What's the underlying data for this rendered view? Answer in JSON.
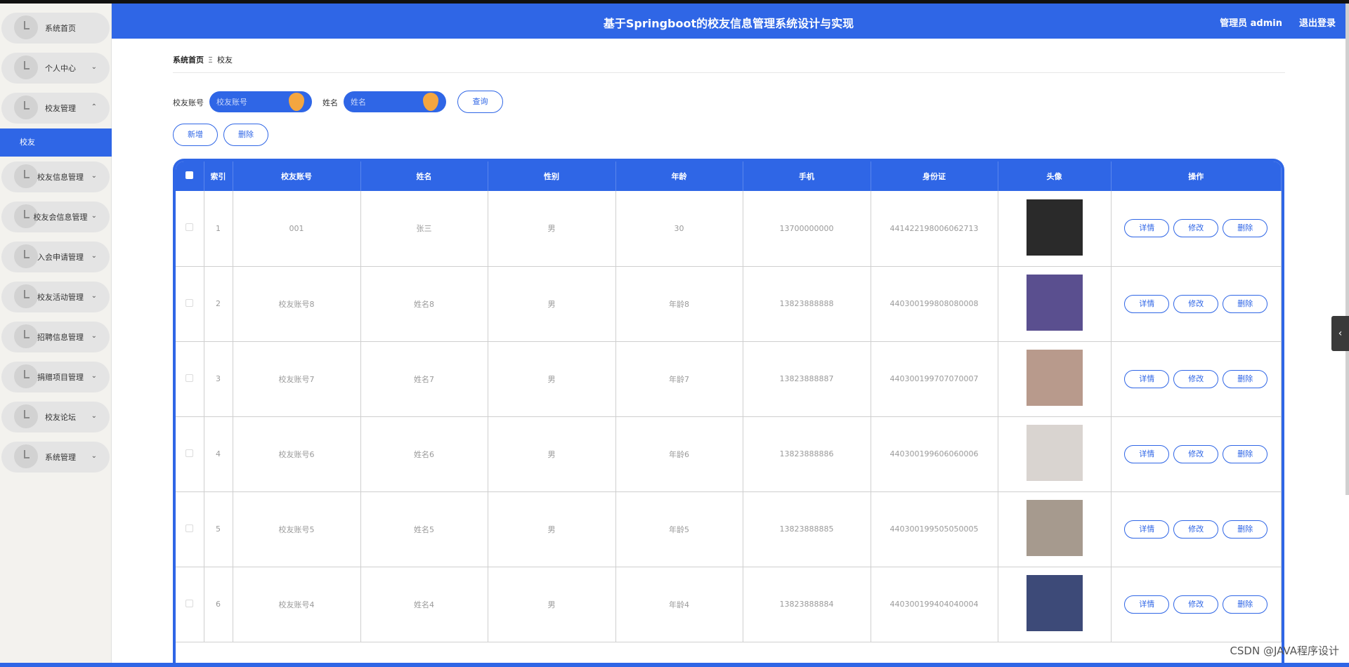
{
  "header": {
    "title": "基于Springboot的校友信息管理系统设计与实现",
    "user": "管理员 admin",
    "logout": "退出登录"
  },
  "sidebar": {
    "items": [
      {
        "label": "系统首页",
        "chevron": ""
      },
      {
        "label": "个人中心",
        "chevron": "⌄"
      },
      {
        "label": "校友管理",
        "chevron": "⌃"
      },
      {
        "label": "校友信息管理",
        "chevron": "⌄"
      },
      {
        "label": "校友会信息管理",
        "chevron": "⌄"
      },
      {
        "label": "入会申请管理",
        "chevron": "⌄"
      },
      {
        "label": "校友活动管理",
        "chevron": "⌄"
      },
      {
        "label": "招聘信息管理",
        "chevron": "⌄"
      },
      {
        "label": "捐赠项目管理",
        "chevron": "⌄"
      },
      {
        "label": "校友论坛",
        "chevron": "⌄"
      },
      {
        "label": "系统管理",
        "chevron": "⌄"
      }
    ],
    "active_sub": "校友"
  },
  "breadcrumb": {
    "home": "系统首页",
    "sep": "Ξ",
    "current": "校友"
  },
  "search": {
    "account_label": "校友账号",
    "account_placeholder": "校友账号",
    "name_label": "姓名",
    "name_placeholder": "姓名",
    "query_button": "查询"
  },
  "actions": {
    "add": "新增",
    "delete": "删除"
  },
  "table": {
    "headers": [
      "",
      "索引",
      "校友账号",
      "姓名",
      "性别",
      "年龄",
      "手机",
      "身份证",
      "头像",
      "操作"
    ],
    "op_labels": {
      "detail": "详情",
      "edit": "修改",
      "delete": "删除"
    },
    "rows": [
      {
        "index": "1",
        "account": "001",
        "name": "张三",
        "gender": "男",
        "age": "30",
        "phone": "13700000000",
        "id_card": "441422198006062713",
        "avatar_color": "#2a2a2a"
      },
      {
        "index": "2",
        "account": "校友账号8",
        "name": "姓名8",
        "gender": "男",
        "age": "年龄8",
        "phone": "13823888888",
        "id_card": "440300199808080008",
        "avatar_color": "#5a4f8f"
      },
      {
        "index": "3",
        "account": "校友账号7",
        "name": "姓名7",
        "gender": "男",
        "age": "年龄7",
        "phone": "13823888887",
        "id_card": "440300199707070007",
        "avatar_color": "#b89a8c"
      },
      {
        "index": "4",
        "account": "校友账号6",
        "name": "姓名6",
        "gender": "男",
        "age": "年龄6",
        "phone": "13823888886",
        "id_card": "440300199606060006",
        "avatar_color": "#d9d4d0"
      },
      {
        "index": "5",
        "account": "校友账号5",
        "name": "姓名5",
        "gender": "男",
        "age": "年龄5",
        "phone": "13823888885",
        "id_card": "440300199505050005",
        "avatar_color": "#a69a8e"
      },
      {
        "index": "6",
        "account": "校友账号4",
        "name": "姓名4",
        "gender": "男",
        "age": "年龄4",
        "phone": "13823888884",
        "id_card": "440300199404040004",
        "avatar_color": "#3d4a78"
      }
    ]
  },
  "watermark": "CSDN @JAVA程序设计",
  "colors": {
    "primary": "#2f66e6",
    "knob": "#f4a640",
    "sidebar_bg": "#f3f2ee"
  }
}
